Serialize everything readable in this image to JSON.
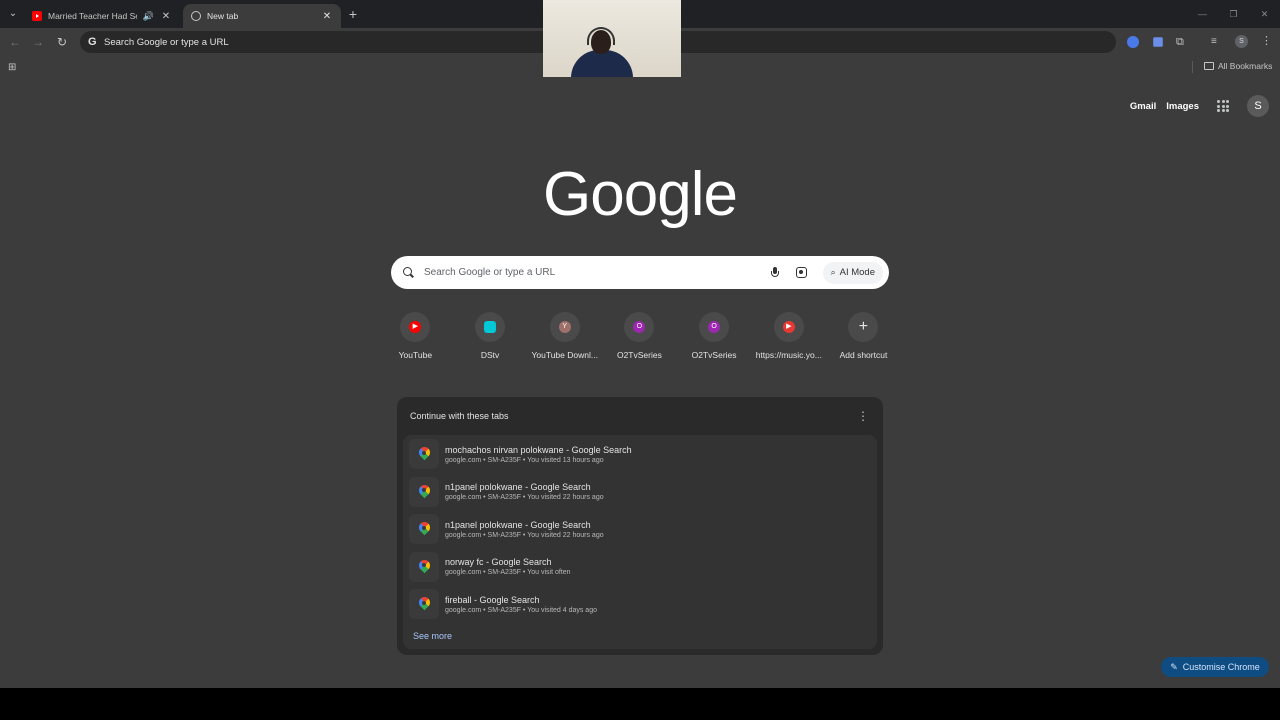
{
  "tabs": [
    {
      "title": "Married Teacher Had Sex W",
      "favicon": "youtube-icon",
      "audio": "🔊",
      "close": "✕"
    },
    {
      "title": "New tab",
      "favicon": "globe-icon",
      "close": "✕"
    }
  ],
  "tabstrip": {
    "tab_search_glyph": "⌄",
    "new_tab_glyph": "+"
  },
  "window_controls": {
    "minimize": "—",
    "maximize": "❐",
    "close": "✕"
  },
  "toolbar": {
    "back": "←",
    "forward": "→",
    "reload": "↻",
    "omnibox_g": "G",
    "omnibox_text": "Search Google or type a URL",
    "extensions_glyph": "⧉",
    "media_glyph": "≡",
    "profile_initial": "S",
    "menu_glyph": "⋮"
  },
  "bookmarks": {
    "apps_glyph": "⊞",
    "all_bookmarks": "All Bookmarks"
  },
  "ntp": {
    "links": {
      "gmail": "Gmail",
      "images": "Images"
    },
    "account_initial": "S",
    "logo": "Google",
    "search_placeholder": "Search Google or type a URL",
    "ai_mode": "AI Mode",
    "ai_glyph": "⌕",
    "shortcuts": [
      {
        "label": "YouTube",
        "color": "#ff0000",
        "glyph": "▶"
      },
      {
        "label": "DStv",
        "color": "#00c8d7",
        "glyph": ""
      },
      {
        "label": "YouTube Downl...",
        "color": "#a0706a",
        "glyph": "Y"
      },
      {
        "label": "O2TvSeries",
        "color": "#9c27b0",
        "glyph": "O"
      },
      {
        "label": "O2TvSeries",
        "color": "#9c27b0",
        "glyph": "O"
      },
      {
        "label": "https://music.yo...",
        "color": "#e53935",
        "glyph": "▶"
      },
      {
        "label": "Add shortcut",
        "color": "",
        "glyph": "+"
      }
    ],
    "continue": {
      "title": "Continue with these tabs",
      "menu_glyph": "⋮",
      "rows": [
        {
          "title": "mochachos nirvan polokwane - Google Search",
          "subtitle": "google.com • SM-A235F • You visited 13 hours ago"
        },
        {
          "title": "n1panel polokwane - Google Search",
          "subtitle": "google.com • SM-A235F • You visited 22 hours ago"
        },
        {
          "title": "n1panel polokwane - Google Search",
          "subtitle": "google.com • SM-A235F • You visited 22 hours ago"
        },
        {
          "title": "norway fc - Google Search",
          "subtitle": "google.com • SM-A235F • You visit often"
        },
        {
          "title": "fireball - Google Search",
          "subtitle": "google.com • SM-A235F • You visited 4 days ago"
        }
      ],
      "see_more": "See more"
    },
    "customise": {
      "label": "Customise Chrome",
      "glyph": "✎"
    }
  }
}
